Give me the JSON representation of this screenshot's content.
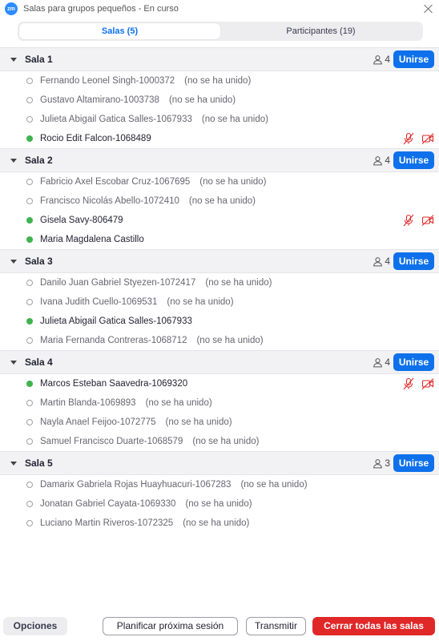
{
  "window": {
    "title": "Salas para grupos pequeños - En curso",
    "logo_text": "zm"
  },
  "tabs": [
    {
      "label": "Salas (5)"
    },
    {
      "label": "Participantes (19)"
    }
  ],
  "rooms": [
    {
      "name": "Sala 1",
      "count": "4",
      "join_label": "Unirse",
      "participants": [
        {
          "name": "Fernando Leonel Singh-1000372",
          "status": "(no se ha unido)"
        },
        {
          "name": "Gustavo Altamirano-1003738",
          "status": "(no se ha unido)"
        },
        {
          "name": "Julieta Abigail Gatica Salles-1067933",
          "status": "(no se ha unido)"
        },
        {
          "name": "Rocio Edit Falcon-1068489",
          "status": ""
        }
      ]
    },
    {
      "name": "Sala 2",
      "count": "4",
      "join_label": "Unirse",
      "participants": [
        {
          "name": "Fabricio Axel Escobar Cruz-1067695",
          "status": "(no se ha unido)"
        },
        {
          "name": "Francisco Nicolás Abello-1072410",
          "status": "(no se ha unido)"
        },
        {
          "name": "Gisela Savy-806479",
          "status": ""
        },
        {
          "name": "Maria Magdalena Castillo",
          "status": ""
        }
      ]
    },
    {
      "name": "Sala 3",
      "count": "4",
      "join_label": "Unirse",
      "participants": [
        {
          "name": "Danilo Juan Gabriel Styezen-1072417",
          "status": "(no se ha unido)"
        },
        {
          "name": "Ivana Judith Cuello-1069531",
          "status": "(no se ha unido)"
        },
        {
          "name": "Julieta Abigail Gatica Salles-1067933",
          "status": ""
        },
        {
          "name": "Maria Fernanda Contreras-1068712",
          "status": "(no se ha unido)"
        }
      ]
    },
    {
      "name": "Sala 4",
      "count": "4",
      "join_label": "Unirse",
      "participants": [
        {
          "name": "Marcos Esteban Saavedra-1069320",
          "status": ""
        },
        {
          "name": "Martin Blanda-1069893",
          "status": "(no se ha unido)"
        },
        {
          "name": "Nayla Anael Feijoo-1072775",
          "status": "(no se ha unido)"
        },
        {
          "name": "Samuel Francisco Duarte-1068579",
          "status": "(no se ha unido)"
        }
      ]
    },
    {
      "name": "Sala 5",
      "count": "3",
      "join_label": "Unirse",
      "participants": [
        {
          "name": "Damarix Gabriela Rojas Huayhuacuri-1067283",
          "status": "(no se ha unido)"
        },
        {
          "name": "Jonatan Gabriel Cayata-1069330",
          "status": "(no se ha unido)"
        },
        {
          "name": "Luciano Martin Riveros-1072325",
          "status": "(no se ha unido)"
        }
      ]
    }
  ],
  "footer": {
    "options_label": "Opciones",
    "plan_label": "Planificar próxima sesión",
    "broadcast_label": "Transmitir",
    "close_all_label": "Cerrar todas las salas"
  },
  "colors": {
    "accent": "#0e71eb",
    "joined": "#3eb34f",
    "danger": "#e02828"
  }
}
